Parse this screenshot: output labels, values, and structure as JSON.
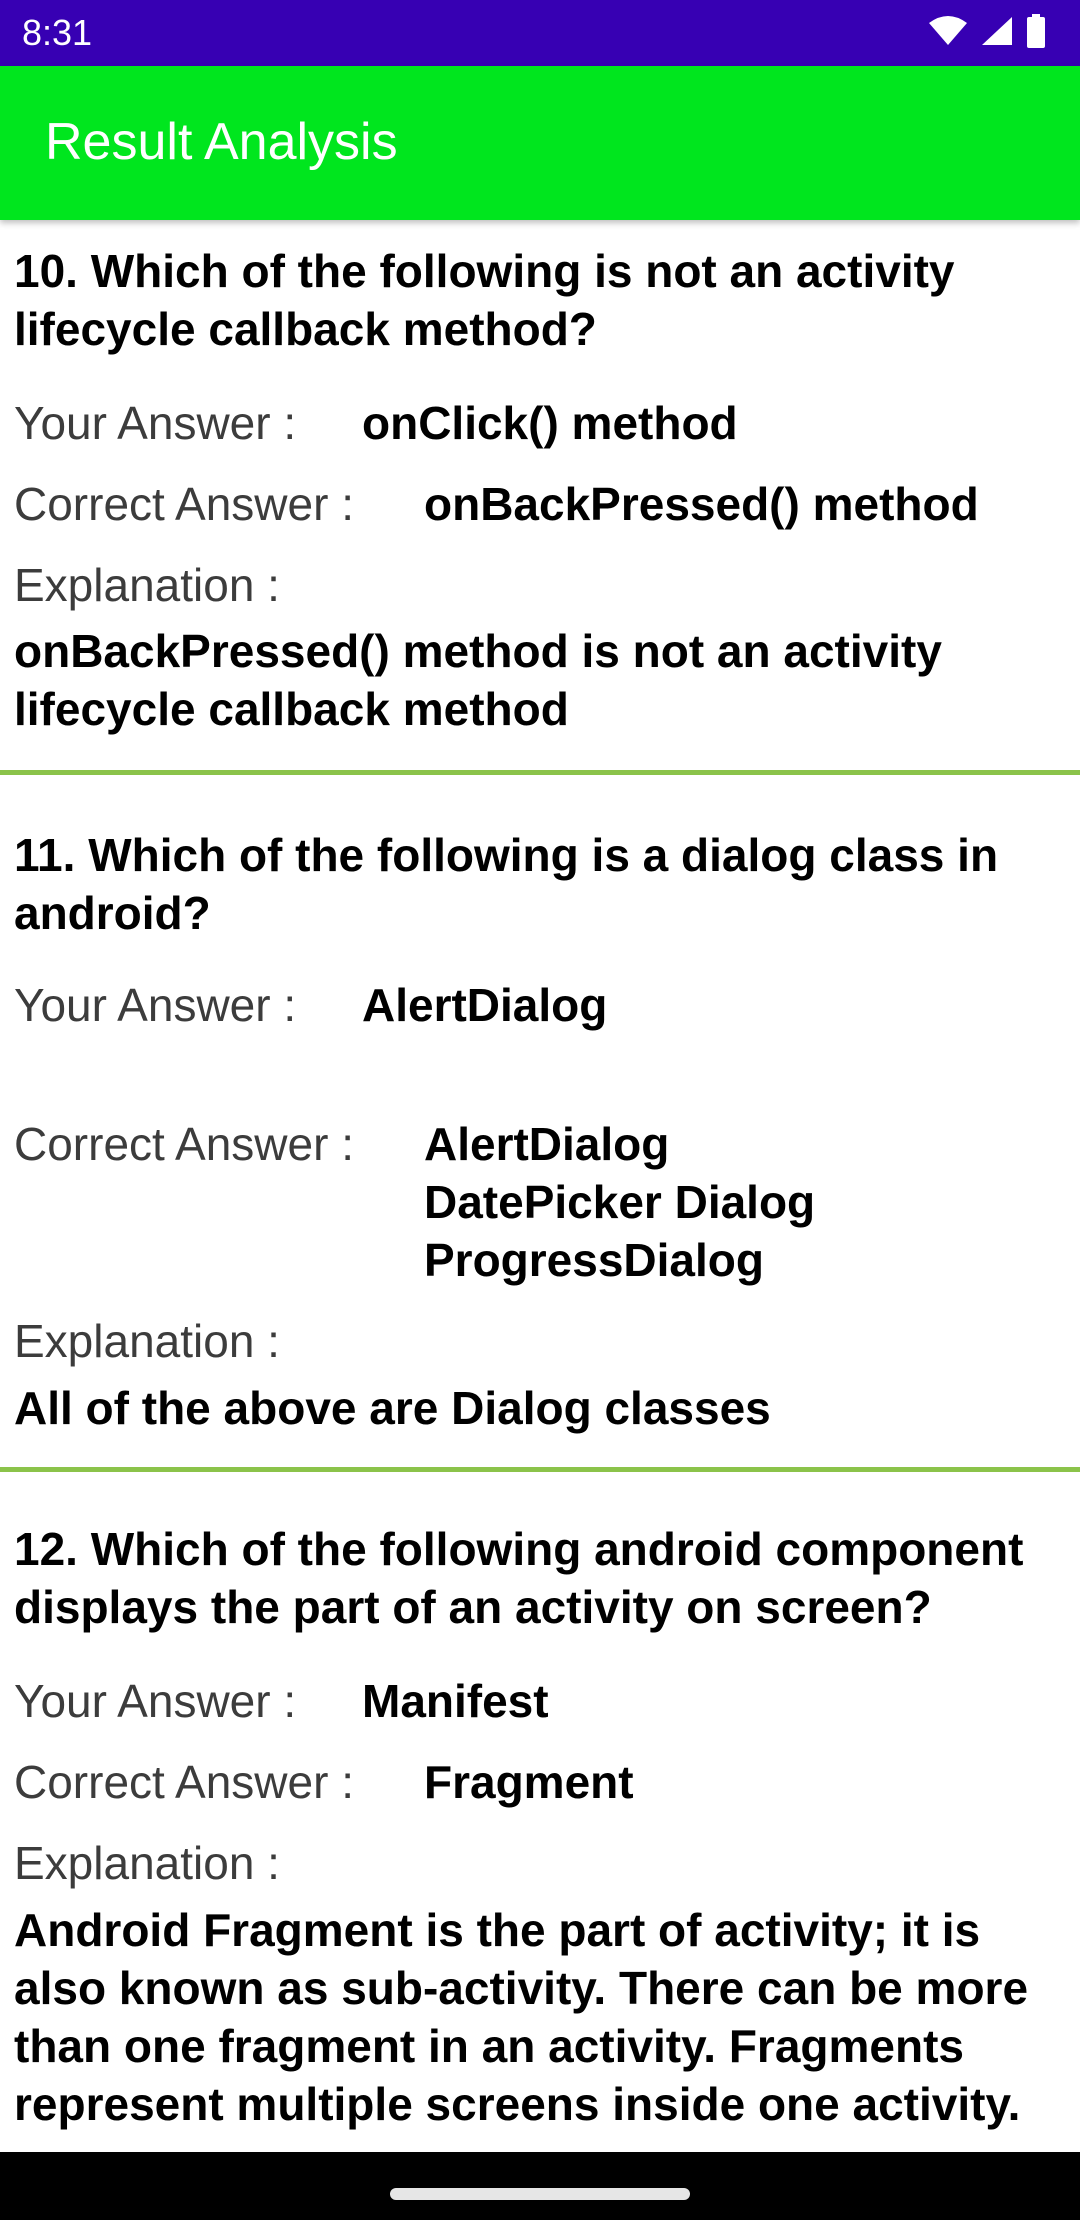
{
  "status_bar": {
    "time": "8:31",
    "icons": [
      "wifi-icon",
      "cellular-signal-icon",
      "battery-icon"
    ]
  },
  "app_bar": {
    "title": "Result Analysis"
  },
  "labels": {
    "your_answer": "Your Answer :",
    "correct_answer": "Correct Answer :",
    "explanation": "Explanation :"
  },
  "questions": [
    {
      "question": "10. Which of the following is not an activity lifecycle callback method?",
      "your_answer": "onClick() method",
      "correct_answer": "onBackPressed() method",
      "explanation": "onBackPressed() method is not an activity lifecycle callback method"
    },
    {
      "question": "11. Which of the following is a dialog class in android?",
      "your_answer": "AlertDialog",
      "correct_answer": "AlertDialog\nDatePicker Dialog\nProgressDialog",
      "explanation": "All of the above are Dialog classes"
    },
    {
      "question": "12. Which of the following android component displays the part of an activity on screen?",
      "your_answer": "Manifest",
      "correct_answer": "Fragment",
      "explanation": "Android Fragment is the part of activity; it is also known as sub-activity. There can be more than one fragment in an activity. Fragments represent multiple screens inside one activity."
    }
  ],
  "colors": {
    "status_bar": "#3700b3",
    "app_bar": "#00e61e",
    "divider": "#8bc34a",
    "nav_bar": "#000000"
  }
}
